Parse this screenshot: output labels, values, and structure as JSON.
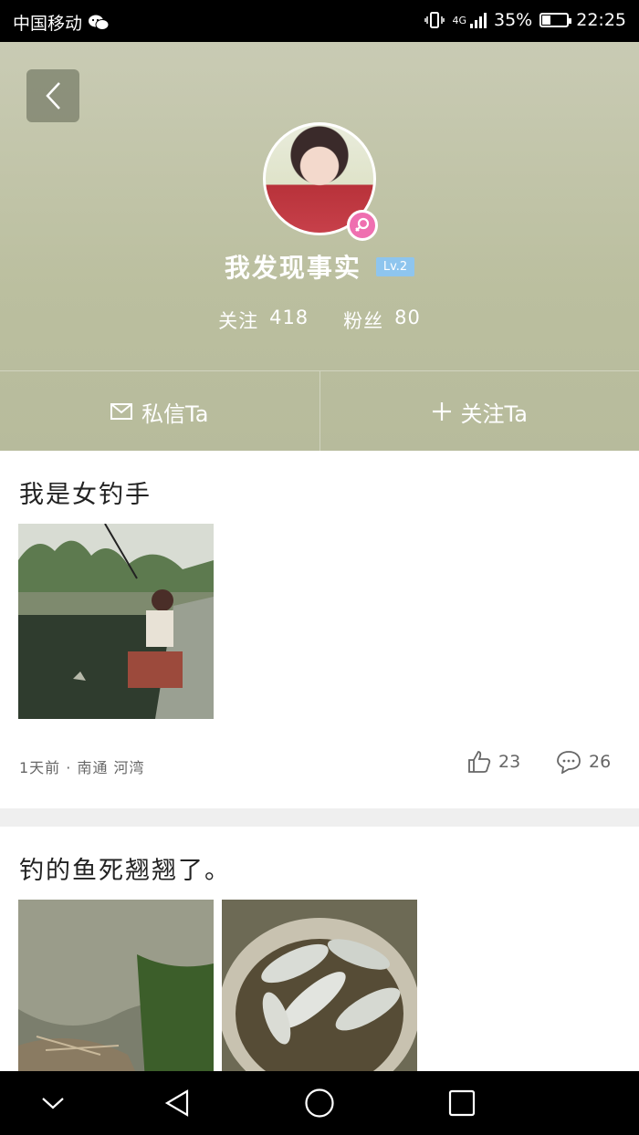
{
  "status_bar": {
    "carrier": "中国移动",
    "network": "4G",
    "battery": "35%",
    "battery_level": 0.35,
    "time": "22:25"
  },
  "profile": {
    "username": "我发现事实",
    "level": "Lv.2",
    "follow_label": "关注",
    "follow_count": "418",
    "fans_label": "粉丝",
    "fans_count": "80",
    "gender_color": "#ef6fb0"
  },
  "actions": {
    "message_label": "私信Ta",
    "follow_label": "关注Ta"
  },
  "posts": [
    {
      "title": "我是女钓手",
      "meta": "1天前 · 南通  河湾",
      "likes": "23",
      "comments": "26"
    },
    {
      "title": "钓的鱼死翘翘了。"
    }
  ],
  "icons": {
    "back": "chevron-left-icon",
    "mail": "mail-icon",
    "plus": "plus-icon",
    "like": "thumbs-up-icon",
    "comment": "comment-icon"
  }
}
